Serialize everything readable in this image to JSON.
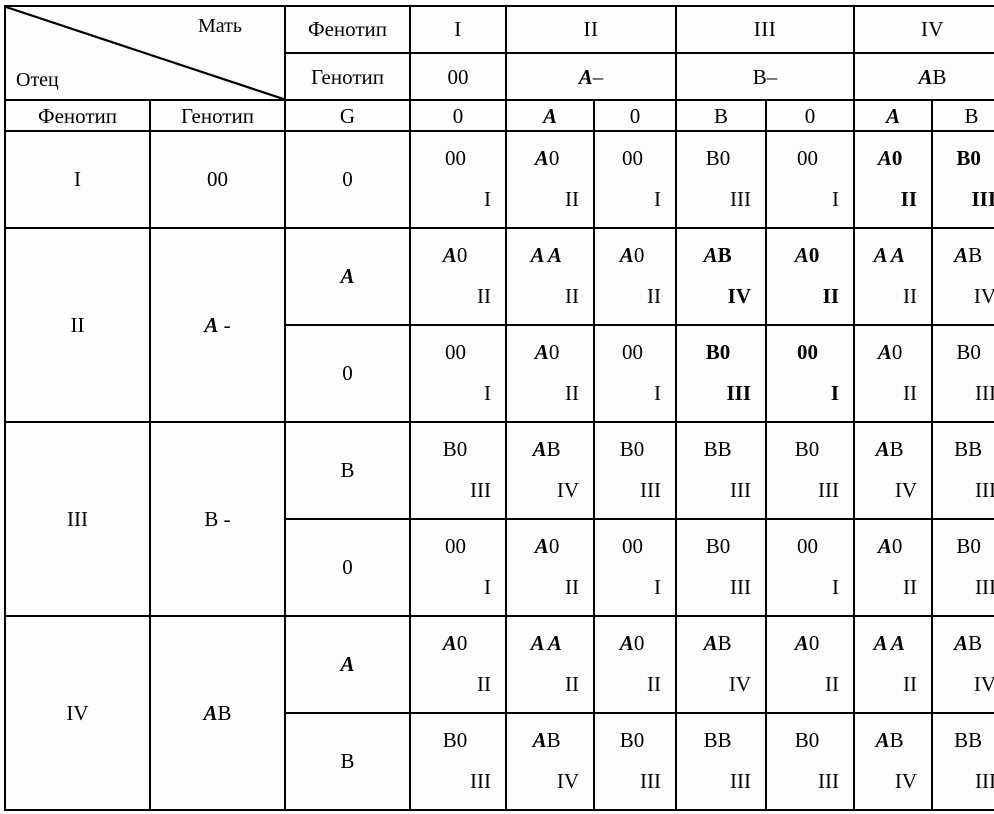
{
  "corner": {
    "mother_label": "Мать",
    "father_label": "Отец"
  },
  "row_headers": {
    "phenotype_label": "Фенотип",
    "genotype_label": "Генотип",
    "gamete_label": "G"
  },
  "mother": {
    "phenotype_label": "Фенотип",
    "genotype_label": "Генотип",
    "groups": [
      {
        "phenotype": "I",
        "genotype": "00",
        "gametes": [
          "0"
        ]
      },
      {
        "phenotype": "II",
        "genotype": "A–",
        "gametes": [
          "A",
          "0"
        ]
      },
      {
        "phenotype": "III",
        "genotype": "B–",
        "gametes": [
          "B",
          "0"
        ]
      },
      {
        "phenotype": "IV",
        "genotype": "AB",
        "gametes": [
          "A",
          "B"
        ]
      }
    ]
  },
  "father": {
    "groups": [
      {
        "phenotype": "I",
        "genotype": "00",
        "gametes": [
          "0"
        ]
      },
      {
        "phenotype": "II",
        "genotype": "A -",
        "gametes": [
          "A",
          "0"
        ]
      },
      {
        "phenotype": "III",
        "genotype": "B -",
        "gametes": [
          "B",
          "0"
        ]
      },
      {
        "phenotype": "IV",
        "genotype": "AB",
        "gametes": [
          "A",
          "B"
        ]
      }
    ]
  },
  "offspring": {
    "gamete_columns": [
      "0",
      "A",
      "0",
      "B",
      "0",
      "A",
      "B"
    ],
    "rows": [
      {
        "father_gamete": "0",
        "cells": [
          {
            "genotype": "00",
            "phenotype": "I",
            "bold": false
          },
          {
            "genotype": "A0",
            "phenotype": "II",
            "bold": false
          },
          {
            "genotype": "00",
            "phenotype": "I",
            "bold": false
          },
          {
            "genotype": "B0",
            "phenotype": "III",
            "bold": false
          },
          {
            "genotype": "00",
            "phenotype": "I",
            "bold": false
          },
          {
            "genotype": "A0",
            "phenotype": "II",
            "bold": true
          },
          {
            "genotype": "B0",
            "phenotype": "III",
            "bold": true
          }
        ]
      },
      {
        "father_gamete": "A",
        "cells": [
          {
            "genotype": "A0",
            "phenotype": "II",
            "bold": false
          },
          {
            "genotype": "A A",
            "phenotype": "II",
            "bold": false
          },
          {
            "genotype": "A0",
            "phenotype": "II",
            "bold": false
          },
          {
            "genotype": "AB",
            "phenotype": "IV",
            "bold": true
          },
          {
            "genotype": "A0",
            "phenotype": "II",
            "bold": true
          },
          {
            "genotype": "A A",
            "phenotype": "II",
            "bold": false
          },
          {
            "genotype": "AB",
            "phenotype": "IV",
            "bold": false
          }
        ]
      },
      {
        "father_gamete": "0",
        "cells": [
          {
            "genotype": "00",
            "phenotype": "I",
            "bold": false
          },
          {
            "genotype": "A0",
            "phenotype": "II",
            "bold": false
          },
          {
            "genotype": "00",
            "phenotype": "I",
            "bold": false
          },
          {
            "genotype": "B0",
            "phenotype": "III",
            "bold": true
          },
          {
            "genotype": "00",
            "phenotype": "I",
            "bold": true
          },
          {
            "genotype": "A0",
            "phenotype": "II",
            "bold": false
          },
          {
            "genotype": "B0",
            "phenotype": "III",
            "bold": false
          }
        ]
      },
      {
        "father_gamete": "B",
        "cells": [
          {
            "genotype": "B0",
            "phenotype": "III",
            "bold": false
          },
          {
            "genotype": "AB",
            "phenotype": "IV",
            "bold": false
          },
          {
            "genotype": "B0",
            "phenotype": "III",
            "bold": false
          },
          {
            "genotype": "BB",
            "phenotype": "III",
            "bold": false
          },
          {
            "genotype": "B0",
            "phenotype": "III",
            "bold": false
          },
          {
            "genotype": "AB",
            "phenotype": "IV",
            "bold": false
          },
          {
            "genotype": "BB",
            "phenotype": "III",
            "bold": false
          }
        ]
      },
      {
        "father_gamete": "0",
        "cells": [
          {
            "genotype": "00",
            "phenotype": "I",
            "bold": false
          },
          {
            "genotype": "A0",
            "phenotype": "II",
            "bold": false
          },
          {
            "genotype": "00",
            "phenotype": "I",
            "bold": false
          },
          {
            "genotype": "B0",
            "phenotype": "III",
            "bold": false
          },
          {
            "genotype": "00",
            "phenotype": "I",
            "bold": false
          },
          {
            "genotype": "A0",
            "phenotype": "II",
            "bold": false
          },
          {
            "genotype": "B0",
            "phenotype": "III",
            "bold": false
          }
        ]
      },
      {
        "father_gamete": "A",
        "cells": [
          {
            "genotype": "A0",
            "phenotype": "II",
            "bold": false
          },
          {
            "genotype": "A A",
            "phenotype": "II",
            "bold": false
          },
          {
            "genotype": "A0",
            "phenotype": "II",
            "bold": false
          },
          {
            "genotype": "AB",
            "phenotype": "IV",
            "bold": false
          },
          {
            "genotype": "A0",
            "phenotype": "II",
            "bold": false
          },
          {
            "genotype": "A A",
            "phenotype": "II",
            "bold": false
          },
          {
            "genotype": "AB",
            "phenotype": "IV",
            "bold": false
          }
        ]
      },
      {
        "father_gamete": "B",
        "cells": [
          {
            "genotype": "B0",
            "phenotype": "III",
            "bold": false
          },
          {
            "genotype": "AB",
            "phenotype": "IV",
            "bold": false
          },
          {
            "genotype": "B0",
            "phenotype": "III",
            "bold": false
          },
          {
            "genotype": "BB",
            "phenotype": "III",
            "bold": false
          },
          {
            "genotype": "B0",
            "phenotype": "III",
            "bold": false
          },
          {
            "genotype": "AB",
            "phenotype": "IV",
            "bold": false
          },
          {
            "genotype": "BB",
            "phenotype": "III",
            "bold": false
          }
        ]
      }
    ]
  },
  "colors": {
    "border": "#000000",
    "text": "#000000",
    "background": "#ffffff"
  }
}
